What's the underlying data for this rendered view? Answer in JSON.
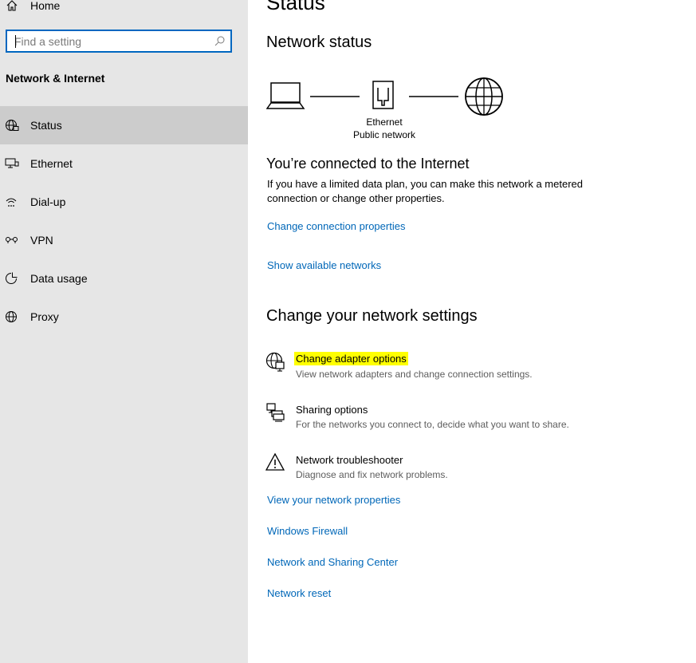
{
  "sidebar": {
    "home_label": "Home",
    "search_placeholder": "Find a setting",
    "section_title": "Network & Internet",
    "items": [
      {
        "label": "Status",
        "icon": "globe-icon",
        "active": true
      },
      {
        "label": "Ethernet",
        "icon": "ethernet-icon"
      },
      {
        "label": "Dial-up",
        "icon": "dialup-icon"
      },
      {
        "label": "VPN",
        "icon": "vpn-icon"
      },
      {
        "label": "Data usage",
        "icon": "data-usage-icon"
      },
      {
        "label": "Proxy",
        "icon": "globe-icon"
      }
    ]
  },
  "main": {
    "title": "Status",
    "network_status_heading": "Network status",
    "diagram": {
      "connection_name": "Ethernet",
      "network_type": "Public network"
    },
    "connected_heading": "You’re connected to the Internet",
    "connected_text": "If you have a limited data plan, you can make this network a metered connection or change other properties.",
    "change_connection_link": "Change connection properties",
    "show_networks_link": "Show available networks",
    "change_settings_heading": "Change your network settings",
    "settings": [
      {
        "title": "Change adapter options",
        "desc": "View network adapters and change connection settings.",
        "icon": "adapter-icon"
      },
      {
        "title": "Sharing options",
        "desc": "For the networks you connect to, decide what you want to share.",
        "icon": "sharing-icon"
      },
      {
        "title": "Network troubleshooter",
        "desc": "Diagnose and fix network problems.",
        "icon": "warning-icon"
      }
    ],
    "links": [
      "View your network properties",
      "Windows Firewall",
      "Network and Sharing Center",
      "Network reset"
    ]
  },
  "colors": {
    "accent": "#0067b8",
    "sidebar_bg": "#e6e6e6",
    "active_bg": "#cccccc",
    "highlight": "#ffff00"
  }
}
